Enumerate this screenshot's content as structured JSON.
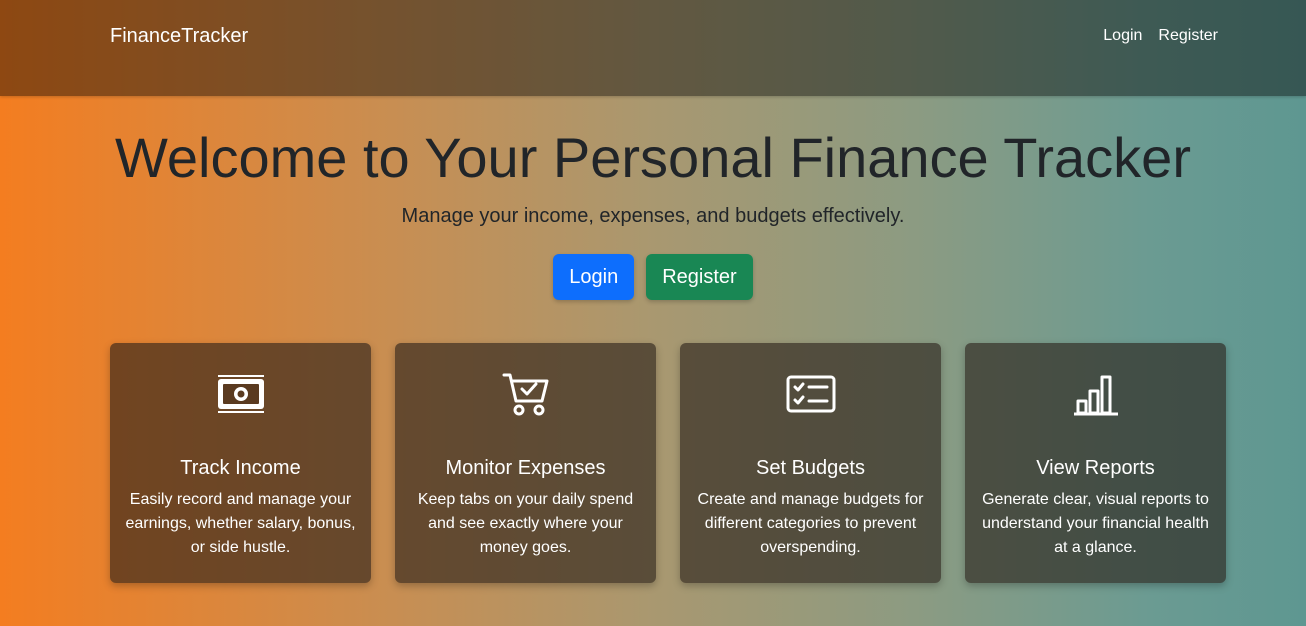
{
  "navbar": {
    "brand": "FinanceTracker",
    "links": [
      "Login",
      "Register"
    ]
  },
  "hero": {
    "title": "Welcome to Your Personal Finance Tracker",
    "subtitle": "Manage your income, expenses, and budgets effectively.",
    "login_label": "Login",
    "register_label": "Register"
  },
  "features": [
    {
      "icon": "cash-icon",
      "title": "Track Income",
      "desc": "Easily record and manage your earnings, whether salary, bonus, or side hustle."
    },
    {
      "icon": "cart-check-icon",
      "title": "Monitor Expenses",
      "desc": "Keep tabs on your daily spend and see exactly where your money goes."
    },
    {
      "icon": "card-checklist-icon",
      "title": "Set Budgets",
      "desc": "Create and manage budgets for different categories to prevent overspending."
    },
    {
      "icon": "bar-chart-icon",
      "title": "View Reports",
      "desc": "Generate clear, visual reports to understand your financial health at a glance."
    }
  ],
  "colors": {
    "primary_button": "#0d6efd",
    "success_button": "#198754",
    "gradient_start": "#f47d20",
    "gradient_end": "#5e9791"
  }
}
